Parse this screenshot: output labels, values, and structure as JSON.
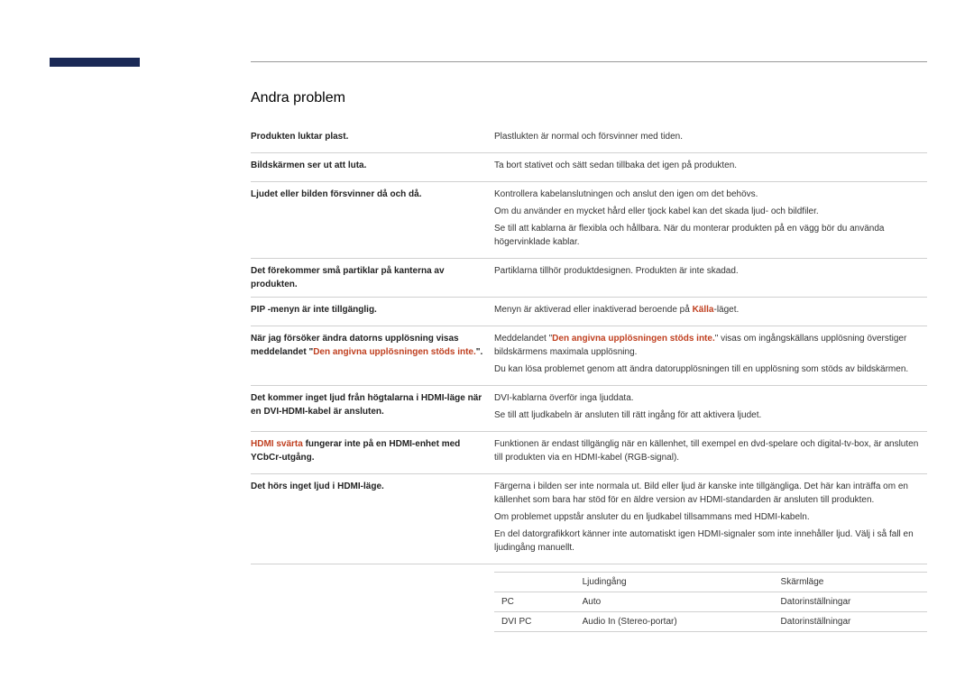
{
  "sectionTitle": "Andra problem",
  "rows": [
    {
      "label": "Produkten luktar plast.",
      "desc": [
        "Plastlukten är normal och försvinner med tiden."
      ]
    },
    {
      "label": "Bildskärmen ser ut att luta.",
      "desc": [
        "Ta bort stativet och sätt sedan tillbaka det igen på produkten."
      ]
    },
    {
      "label": "Ljudet eller bilden försvinner då och då.",
      "desc": [
        "Kontrollera kabelanslutningen och anslut den igen om det behövs.",
        "Om du använder en mycket hård eller tjock kabel kan det skada ljud- och bildfiler.",
        "Se till att kablarna är flexibla och hållbara. När du monterar produkten på en vägg bör du använda högervinklade kablar."
      ]
    },
    {
      "label": "Det förekommer små partiklar på kanterna av produkten.",
      "desc": [
        "Partiklarna tillhör produktdesignen. Produkten är inte skadad."
      ]
    },
    {
      "labelParts": [
        {
          "text": "PIP",
          "class": "bold"
        },
        {
          "text": " -menyn är inte tillgänglig.",
          "class": ""
        }
      ],
      "desc": [
        {
          "parts": [
            {
              "text": "Menyn är aktiverad eller inaktiverad beroende på ",
              "class": ""
            },
            {
              "text": "Källa",
              "class": "highlight"
            },
            {
              "text": "-läget.",
              "class": ""
            }
          ]
        }
      ]
    },
    {
      "labelParts": [
        {
          "text": "När jag försöker ändra datorns upplösning visas meddelandet \"",
          "class": ""
        },
        {
          "text": "Den angivna upplösningen stöds inte.",
          "class": "highlight"
        },
        {
          "text": "\".",
          "class": ""
        }
      ],
      "desc": [
        {
          "parts": [
            {
              "text": "Meddelandet \"",
              "class": ""
            },
            {
              "text": "Den angivna upplösningen stöds inte.",
              "class": "highlight"
            },
            {
              "text": "\" visas om ingångskällans upplösning överstiger bildskärmens maximala upplösning.",
              "class": ""
            }
          ]
        },
        "Du kan lösa problemet genom att ändra datorupplösningen till en upplösning som stöds av bildskärmen."
      ]
    },
    {
      "label": "Det kommer inget ljud från högtalarna i HDMI-läge när en DVI-HDMI-kabel är ansluten.",
      "desc": [
        "DVI-kablarna överför inga ljuddata.",
        "Se till att ljudkabeln är ansluten till rätt ingång för att aktivera ljudet."
      ]
    },
    {
      "labelParts": [
        {
          "text": "HDMI svärta",
          "class": "highlight"
        },
        {
          "text": " fungerar inte på en HDMI-enhet med YCbCr-utgång.",
          "class": ""
        }
      ],
      "desc": [
        "Funktionen är endast tillgänglig när en källenhet, till exempel en dvd-spelare och digital-tv-box, är ansluten till produkten via en HDMI-kabel (RGB-signal)."
      ]
    },
    {
      "label": "Det hörs inget ljud i HDMI-läge.",
      "desc": [
        "Färgerna i bilden ser inte normala ut. Bild eller ljud är kanske inte tillgängliga. Det här kan inträffa om en källenhet som bara har stöd för en äldre version av HDMI-standarden är ansluten till produkten.",
        "Om problemet uppstår ansluter du en ljudkabel tillsammans med HDMI-kabeln.",
        "En del datorgrafikkort känner inte automatiskt igen HDMI-signaler som inte innehåller ljud. Välj i så fall en ljudingång manuellt."
      ],
      "table": {
        "headers": [
          "",
          "Ljudingång",
          "Skärmläge"
        ],
        "rowsData": [
          [
            "PC",
            "Auto",
            "Datorinställningar"
          ],
          [
            "DVI PC",
            "Audio In (Stereo-portar)",
            "Datorinställningar"
          ]
        ]
      }
    }
  ]
}
